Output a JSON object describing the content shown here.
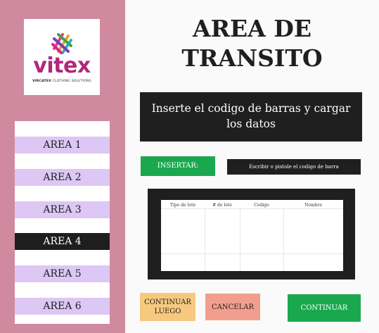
{
  "logo": {
    "brand": "vitex",
    "subtitle_strong": "VIRCATEX",
    "subtitle_rest": " CLOTHING SOLUTIONS"
  },
  "sidebar": {
    "items": [
      {
        "label": "AREA 1",
        "active": false
      },
      {
        "label": "AREA 2",
        "active": false
      },
      {
        "label": "AREA 3",
        "active": false
      },
      {
        "label": "AREA 4",
        "active": true
      },
      {
        "label": "AREA 5",
        "active": false
      },
      {
        "label": "AREA 6",
        "active": false
      }
    ]
  },
  "header": {
    "title_line1": "AREA DE",
    "title_line2": "TRANSITO"
  },
  "banner": {
    "text": "Inserte el codigo de barras y cargar los datos"
  },
  "form": {
    "insert_label": "INSERTAR:",
    "barcode_placeholder": "Escribir o pistole el codigo de barra"
  },
  "table": {
    "columns": [
      "Tipo de lote",
      "# de lote",
      "Codigo",
      "Nombre"
    ]
  },
  "actions": {
    "later_line1": "CONTINUAR",
    "later_line2": "LUEGO",
    "cancel": "CANCELAR",
    "continue": "CONTINUAR"
  },
  "colors": {
    "sidebar_bg": "#d08aa0",
    "area_item": "#dcc7f5",
    "area_active": "#1e1e1e",
    "dark_panel": "#1f1f1f",
    "green": "#1aa84f",
    "orange": "#f7c97f",
    "salmon": "#f29e8e",
    "brand": "#b0287a"
  }
}
